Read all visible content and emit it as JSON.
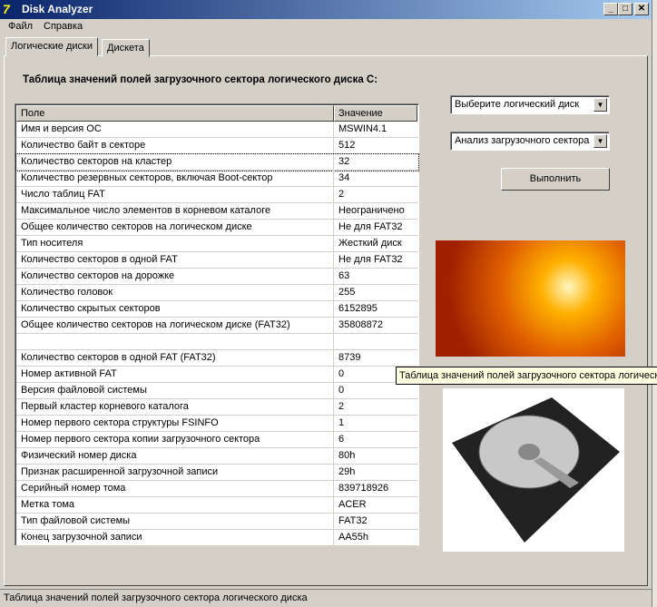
{
  "window": {
    "title": "Disk Analyzer",
    "logo": "7"
  },
  "menu": [
    "Файл",
    "Справка"
  ],
  "tabs": [
    "Логические диски",
    "Дискета"
  ],
  "heading": "Таблица значений полей загрузочного сектора логического диска C:",
  "table": {
    "headers": [
      "Поле",
      "Значение"
    ],
    "rows": [
      [
        "Имя и версия ОС",
        "MSWIN4.1"
      ],
      [
        "Количество байт в секторе",
        "512"
      ],
      [
        "Количество секторов на кластер",
        "32"
      ],
      [
        "Количество резервных секторов, включая Boot-сектор",
        "34"
      ],
      [
        "Число таблиц FAT",
        "2"
      ],
      [
        "Максимальное число элементов в корневом каталоге",
        "Неограничено"
      ],
      [
        "Общее количество секторов на логическом диске",
        "Не для FAT32"
      ],
      [
        "Тип носителя",
        "Жесткий диск"
      ],
      [
        "Количество секторов в одной FAT",
        "Не для FAT32"
      ],
      [
        "Количество секторов на дорожке",
        "63"
      ],
      [
        "Количество головок",
        "255"
      ],
      [
        "Количество скрытых секторов",
        "6152895"
      ],
      [
        "Общее количество секторов на логическом диске (FAT32)",
        "35808872"
      ],
      [
        "",
        ""
      ],
      [
        "Количество секторов в одной FAT (FAT32)",
        "8739"
      ],
      [
        "Номер активной FAT",
        "0"
      ],
      [
        "Версия файловой системы",
        "0"
      ],
      [
        "Первый кластер корневого каталога",
        "2"
      ],
      [
        "Номер первого сектора структуры FSINFO",
        "1"
      ],
      [
        "Номер первого сектора копии загрузочного сектора",
        "6"
      ],
      [
        "Физический номер диска",
        "80h"
      ],
      [
        "Признак расширенной загрузочной записи",
        "29h"
      ],
      [
        "Серийный номер тома",
        "839718926"
      ],
      [
        "Метка тома",
        "ACER"
      ],
      [
        "Тип файловой системы",
        "FAT32"
      ],
      [
        "Конец загрузочной записи",
        "AA55h"
      ]
    ]
  },
  "controls": {
    "disk_select": "Выберите логический диск",
    "mode_select": "Анализ загрузочного сектора",
    "run": "Выполнить"
  },
  "tooltip": "Таблица значений  полей загрузочного сектора логического диска",
  "status": "Таблица значений  полей загрузочного сектора логического диска"
}
